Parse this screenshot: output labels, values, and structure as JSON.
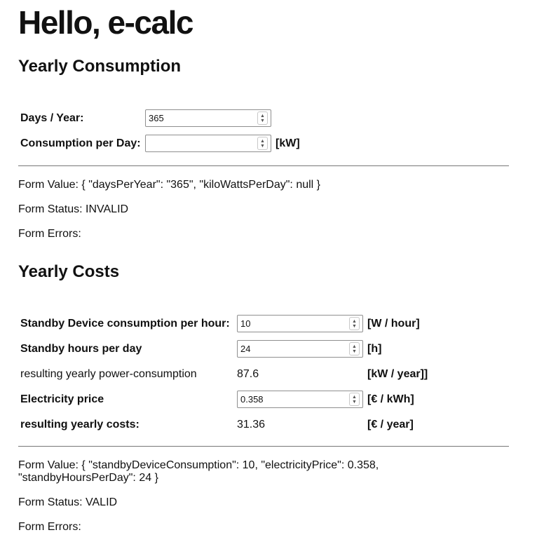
{
  "page": {
    "title": "Hello, e-calc"
  },
  "consumption": {
    "heading": "Yearly Consumption",
    "fields": [
      {
        "label": "Days / Year:",
        "value": "365",
        "unit": ""
      },
      {
        "label": "Consumption per Day:",
        "value": "",
        "unit": "[kW]"
      }
    ],
    "form_value": "Form Value: { \"daysPerYear\": \"365\", \"kiloWattsPerDay\": null }",
    "form_status": "Form Status: INVALID",
    "form_errors": "Form Errors:"
  },
  "costs": {
    "heading": "Yearly Costs",
    "standby_consumption": {
      "label": "Standby Device consumption per hour:",
      "value": "10",
      "unit": "[W / hour]"
    },
    "standby_hours": {
      "label": "Standby hours per day",
      "value": "24",
      "unit": "[h]"
    },
    "yearly_power": {
      "label": "resulting yearly power-consumption",
      "value": "87.6",
      "unit": "[kW / year]]"
    },
    "electricity_price": {
      "label": "Electricity price",
      "value": "0.358",
      "unit": "[€ / kWh]"
    },
    "yearly_costs": {
      "label": "resulting yearly costs:",
      "value": "31.36",
      "unit": "[€ / year]"
    },
    "form_value_line1": "Form Value: { \"standbyDeviceConsumption\": 10, \"electricityPrice\": 0.358,",
    "form_value_line2": "\"standbyHoursPerDay\": 24 }",
    "form_status": "Form Status: VALID",
    "form_errors": "Form Errors:"
  }
}
